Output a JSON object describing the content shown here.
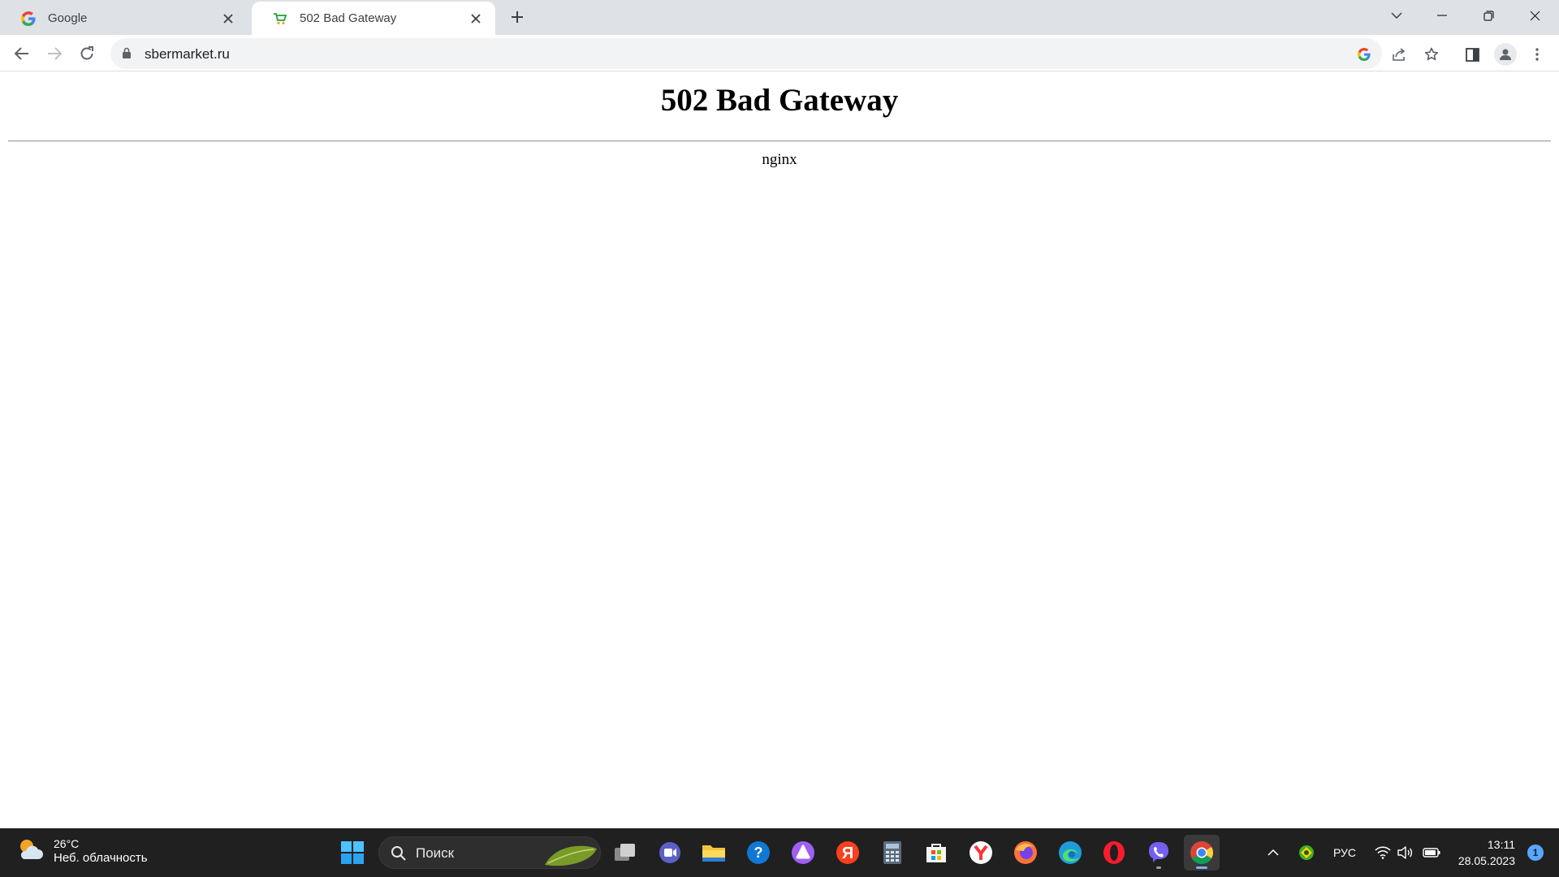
{
  "browser": {
    "tabs": [
      {
        "title": "Google",
        "favicon": "google-g-icon",
        "active": false
      },
      {
        "title": "502 Bad Gateway",
        "favicon": "cart-icon",
        "active": true
      }
    ],
    "url": "sbermarket.ru"
  },
  "page": {
    "heading": "502 Bad Gateway",
    "server": "nginx"
  },
  "taskbar": {
    "weather": {
      "temperature": "26°C",
      "condition": "Неб. облачность"
    },
    "search_placeholder": "Поиск",
    "apps": [
      "start-icon",
      "task-view-icon",
      "chat-icon",
      "file-explorer-icon",
      "help-icon",
      "alice-icon",
      "yandex-icon",
      "calculator-icon",
      "store-icon",
      "yandex-browser-icon",
      "firefox-icon",
      "edge-icon",
      "opera-icon",
      "viber-icon",
      "chrome-icon"
    ],
    "language": "РУС",
    "time": "13:11",
    "date": "28.05.2023",
    "notification_count": "1"
  },
  "colors": {
    "tabstrip": "#dee1e6",
    "taskbar": "#202020",
    "accent": "#1a73e8"
  }
}
